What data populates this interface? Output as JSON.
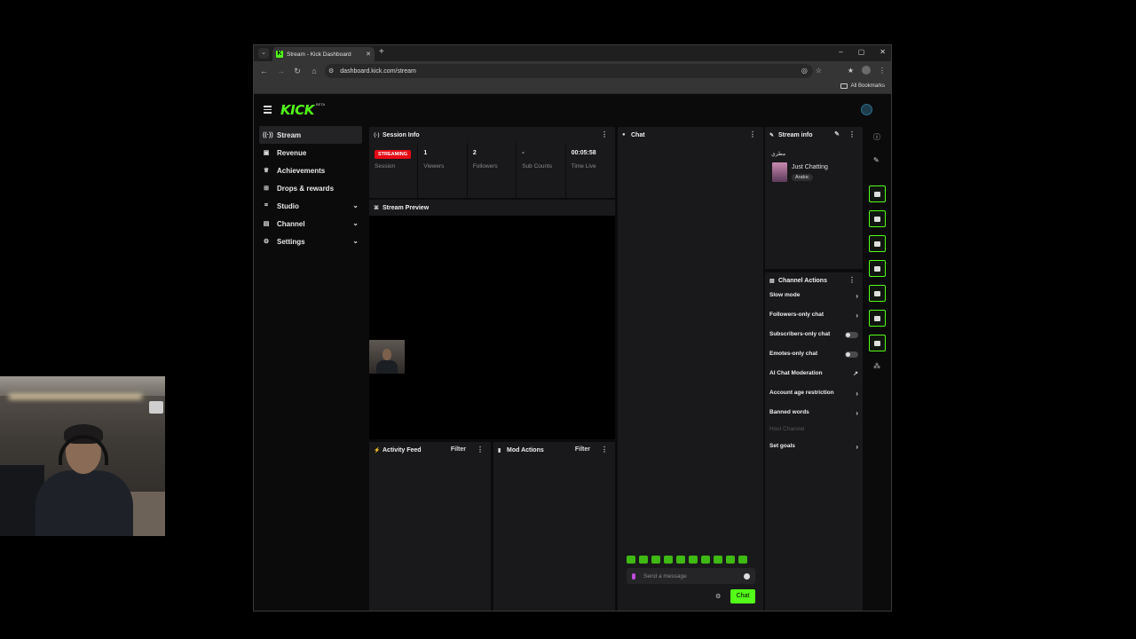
{
  "browser": {
    "tab_title": "Stream - Kick Dashboard",
    "url": "dashboard.kick.com/stream",
    "bookmarks_label": "All Bookmarks"
  },
  "app": {
    "logo": "KICK",
    "logo_badge": "BETA"
  },
  "sidebar": {
    "items": [
      {
        "label": "Stream",
        "icon": "broadcast-icon"
      },
      {
        "label": "Revenue",
        "icon": "wallet-icon"
      },
      {
        "label": "Achievements",
        "icon": "trophy-icon"
      },
      {
        "label": "Drops & rewards",
        "icon": "gift-icon"
      },
      {
        "label": "Studio",
        "icon": "studio-icon"
      },
      {
        "label": "Channel",
        "icon": "channel-icon"
      },
      {
        "label": "Settings",
        "icon": "gear-icon"
      }
    ]
  },
  "session_info": {
    "title": "Session Info",
    "status": "STREAMING",
    "stats": [
      {
        "value": "",
        "label": "Session"
      },
      {
        "value": "1",
        "label": "Viewers"
      },
      {
        "value": "2",
        "label": "Followers"
      },
      {
        "value": "-",
        "label": "Sub Counts"
      },
      {
        "value": "00:05:58",
        "label": "Time Live"
      }
    ]
  },
  "stream_preview": {
    "title": "Stream Preview"
  },
  "activity_feed": {
    "title": "Activity Feed",
    "filter": "Filter"
  },
  "mod_actions": {
    "title": "Mod Actions",
    "filter": "Filter"
  },
  "chat": {
    "title": "Chat",
    "placeholder": "Send a message",
    "send_label": "Chat"
  },
  "stream_info": {
    "title": "Stream info",
    "stream_title": "مطري",
    "category": "Just Chatting",
    "tag": "Arabic"
  },
  "channel_actions": {
    "title": "Channel Actions",
    "items": [
      {
        "label": "Slow mode"
      },
      {
        "label": "Followers-only chat"
      },
      {
        "label": "Subscribers-only chat"
      },
      {
        "label": "Emotes-only chat"
      },
      {
        "label": "AI Chat Moderation"
      },
      {
        "label": "Account age restriction"
      },
      {
        "label": "Banned words"
      },
      {
        "label": "Host Channel"
      },
      {
        "label": "Set goals"
      }
    ]
  },
  "colors": {
    "accent": "#53fc18",
    "streaming_badge": "#e50914"
  }
}
